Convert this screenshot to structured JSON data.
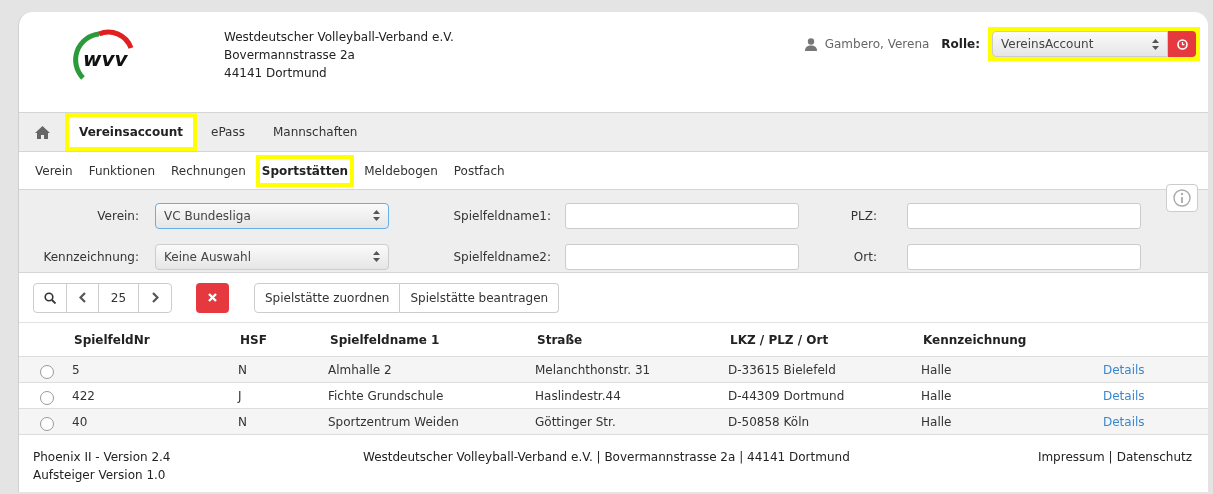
{
  "header": {
    "logo_text": "wvv",
    "address_lines": [
      "Westdeutscher Volleyball-Verband e.V.",
      "Bovermannstrasse 2a",
      "44141 Dortmund"
    ],
    "user": "Gambero, Verena",
    "role_label": "Rolle:",
    "role_value": "VereinsAccount",
    "role_highlighted": true
  },
  "main_nav": [
    {
      "label": "Vereinsaccount",
      "selected": true,
      "highlighted": true
    },
    {
      "label": "ePass",
      "selected": false,
      "highlighted": false
    },
    {
      "label": "Mannschaften",
      "selected": false,
      "highlighted": false
    }
  ],
  "sub_nav": [
    {
      "label": "Verein",
      "selected": false,
      "highlighted": false
    },
    {
      "label": "Funktionen",
      "selected": false,
      "highlighted": false
    },
    {
      "label": "Rechnungen",
      "selected": false,
      "highlighted": false
    },
    {
      "label": "Sportstätten",
      "selected": true,
      "highlighted": true
    },
    {
      "label": "Meldebogen",
      "selected": false,
      "highlighted": false
    },
    {
      "label": "Postfach",
      "selected": false,
      "highlighted": false
    }
  ],
  "filters": {
    "verein": {
      "label": "Verein:",
      "value": "VC Bundesliga",
      "focused": true
    },
    "kennzeichnung": {
      "label": "Kennzeichnung:",
      "value": "Keine Auswahl",
      "focused": false
    },
    "spielfeldname1": {
      "label": "Spielfeldname1:"
    },
    "spielfeldname2": {
      "label": "Spielfeldname2:"
    },
    "plz": {
      "label": "PLZ:"
    },
    "ort": {
      "label": "Ort:"
    }
  },
  "toolbar": {
    "page_size": "25",
    "buttons": [
      "Spielstätte zuordnen",
      "Spielstätte beantragen"
    ]
  },
  "table": {
    "columns": [
      "SpielfeldNr",
      "HSF",
      "Spielfeldname 1",
      "Straße",
      "LKZ / PLZ / Ort",
      "Kennzeichnung"
    ],
    "rows": [
      {
        "selected": false,
        "cells": [
          "5",
          "N",
          "Almhalle 2",
          "Melanchthonstr. 31",
          "D-33615 Bielefeld",
          "Halle"
        ],
        "link": "Details"
      },
      {
        "selected": false,
        "cells": [
          "422",
          "J",
          "Fichte Grundschule",
          "Haslindestr.44",
          "D-44309 Dortmund",
          "Halle"
        ],
        "link": "Details"
      },
      {
        "selected": false,
        "cells": [
          "40",
          "N",
          "Sportzentrum Weiden",
          "Göttinger Str.",
          "D-50858 Köln",
          "Halle"
        ],
        "link": "Details"
      }
    ]
  },
  "footer": {
    "version_lines": [
      "Phoenix II - Version 2.4",
      "Aufsteiger Version 1.0"
    ],
    "address": "Westdeutscher Volleyball-Verband e.V. | Bovermannstrasse 2a | 44141 Dortmund",
    "links": [
      "Impressum",
      "Datenschutz"
    ],
    "separator": "|"
  }
}
